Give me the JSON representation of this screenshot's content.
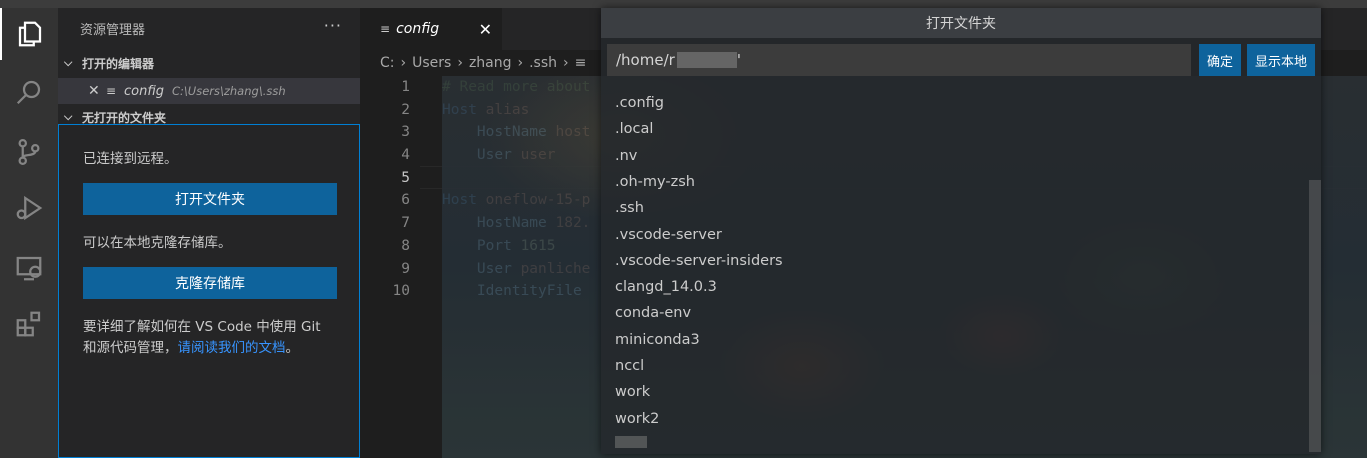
{
  "sidebar": {
    "title": "资源管理器",
    "more": "···",
    "open_editors_label": "打开的编辑器",
    "open_editor_item": {
      "name": "config",
      "path": "C:\\Users\\zhang\\.ssh"
    },
    "no_folder_label": "无打开的文件夹",
    "connected_text": "已连接到远程。",
    "open_folder_button": "打开文件夹",
    "clone_text": "可以在本地克隆存储库。",
    "clone_button": "克隆存储库",
    "learn_text": "要详细了解如何在 VS Code 中使用 Git 和源代码管理，",
    "learn_link": "请阅读我们的文档",
    "learn_end": "。"
  },
  "tab": {
    "label": "config",
    "close": "✕"
  },
  "breadcrumb": [
    "C:",
    "Users",
    "zhang",
    ".ssh"
  ],
  "editor": {
    "line_numbers": [
      "1",
      "2",
      "3",
      "4",
      "5",
      "6",
      "7",
      "8",
      "9",
      "10"
    ],
    "current_line": 5,
    "lines": [
      [
        {
          "t": "# Read more about",
          "c": "com"
        }
      ],
      [
        {
          "t": "Host",
          "c": "kw"
        },
        {
          "t": " alias",
          "c": "val"
        }
      ],
      [
        {
          "t": "    HostName",
          "c": "key"
        },
        {
          "t": " host",
          "c": "val"
        }
      ],
      [
        {
          "t": "    User",
          "c": "key"
        },
        {
          "t": " user",
          "c": "val"
        }
      ],
      [
        {
          "t": "",
          "c": "val"
        }
      ],
      [
        {
          "t": "Host",
          "c": "kw"
        },
        {
          "t": " oneflow-15-p",
          "c": "val"
        }
      ],
      [
        {
          "t": "    HostName",
          "c": "key"
        },
        {
          "t": " 182.",
          "c": "val"
        }
      ],
      [
        {
          "t": "    Port",
          "c": "key"
        },
        {
          "t": " 1615",
          "c": "num"
        }
      ],
      [
        {
          "t": "    User",
          "c": "key"
        },
        {
          "t": " panliche",
          "c": "val"
        }
      ],
      [
        {
          "t": "    IdentityFile",
          "c": "key"
        }
      ]
    ]
  },
  "dialog": {
    "title": "打开文件夹",
    "input_value": "/home/r",
    "input_suffix": "'",
    "ok_button": "确定",
    "show_local_button": "显示本地",
    "items": [
      ".config",
      ".local",
      ".nv",
      ".oh-my-zsh",
      ".ssh",
      ".vscode-server",
      ".vscode-server-insiders",
      "clangd_14.0.3",
      "conda-env",
      "miniconda3",
      "nccl",
      "work",
      "work2"
    ]
  },
  "colors": {
    "accent": "#0e639c",
    "link": "#3794ff",
    "focus_border": "#007fd4"
  }
}
